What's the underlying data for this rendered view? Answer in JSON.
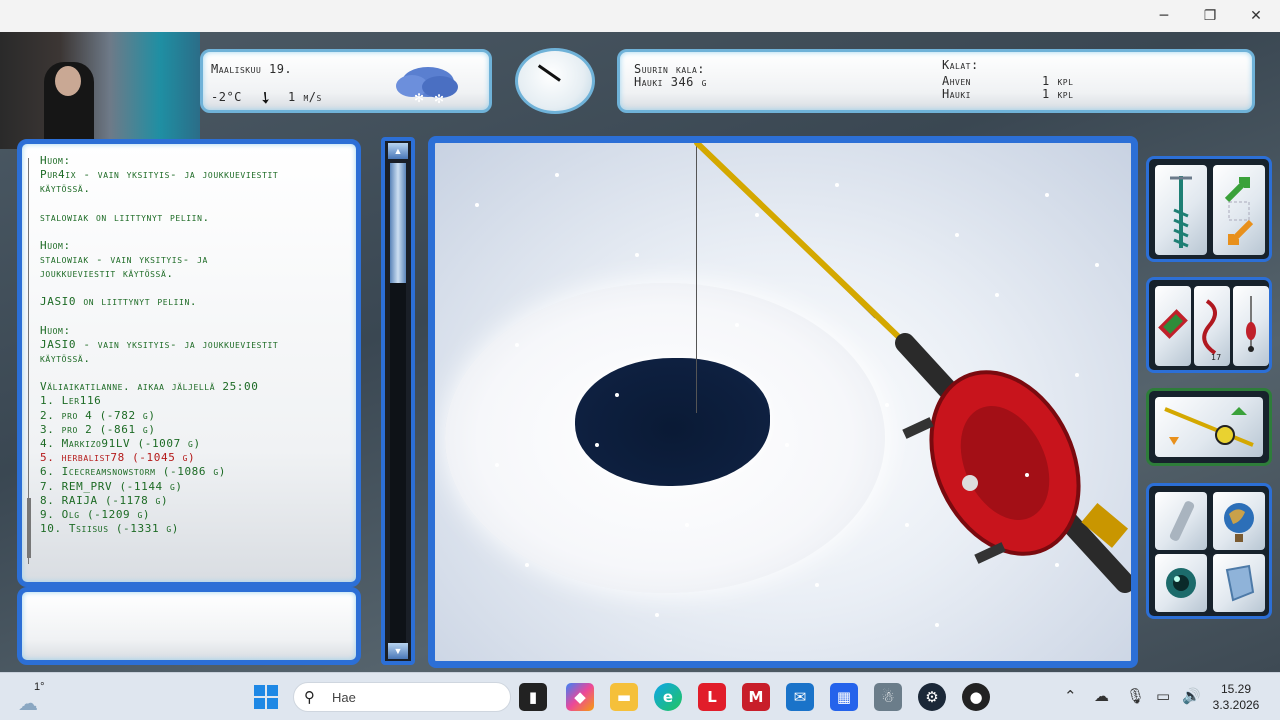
{
  "window": {
    "minimize_icon": "minimize-icon",
    "maximize_icon": "restore-icon",
    "close_icon": "close-icon",
    "minimize_glyph": "─",
    "maximize_glyph": "❐",
    "close_glyph": "✕"
  },
  "weather": {
    "date": "Maaliskuu 19.",
    "temperature": "-2°C",
    "wind": "1 m/s",
    "condition_icon": "snow-cloud-icon"
  },
  "catch": {
    "biggest_title": "Suurin kala:",
    "biggest_value": "Hauki 346 g",
    "fish_title": "Kalat:",
    "fish": [
      {
        "name": "Ahven",
        "count": "1 kpl"
      },
      {
        "name": "Hauki",
        "count": "1 kpl"
      }
    ]
  },
  "chat": {
    "lines": [
      {
        "text": "Huom:",
        "hl": false
      },
      {
        "text": "Pur4ix - vain yksityis- ja joukkueviestit\nkäytössä.",
        "hl": false
      },
      {
        "gap": true
      },
      {
        "text": "stalowiak on liittynyt peliin.",
        "hl": false
      },
      {
        "gap": true
      },
      {
        "text": "Huom:",
        "hl": false
      },
      {
        "text": "stalowiak - vain yksityis- ja\njoukkueviestit käytössä.",
        "hl": false
      },
      {
        "gap": true
      },
      {
        "text": "JASI0 on liittynyt peliin.",
        "hl": false
      },
      {
        "gap": true
      },
      {
        "text": "Huom:",
        "hl": false
      },
      {
        "text": "JASI0 - vain yksityis- ja joukkueviestit\nkäytössä.",
        "hl": false
      },
      {
        "gap": true
      },
      {
        "text": "Väliaikatilanne. aikaa jäljellä 25:00",
        "hl": false
      },
      {
        "text": "1. Ler116",
        "hl": false
      },
      {
        "text": "2. pro 4 (-782 g)",
        "hl": false
      },
      {
        "text": "3. pro 2 (-861 g)",
        "hl": false
      },
      {
        "text": "4. Markizo91LV (-1007 g)",
        "hl": false
      },
      {
        "text": "5. herbalist78 (-1045 g)",
        "hl": true
      },
      {
        "text": "6. Icecreamsnowstorm (-1086 g)",
        "hl": false
      },
      {
        "text": "7. REM_PRV (-1144 g)",
        "hl": false
      },
      {
        "text": "8. RAIJA (-1178 g)",
        "hl": false
      },
      {
        "text": "9. Olg (-1209 g)",
        "hl": false
      },
      {
        "text": "10. Tsiisus (-1331 g)",
        "hl": false
      }
    ]
  },
  "depth_slider": {
    "level": 0.25
  },
  "tools": {
    "group1": [
      "ice-drill-icon",
      "switch-arrows-icon"
    ],
    "group2": [
      "lure-icon",
      "worm-icon",
      "jig-icon"
    ],
    "group3": [
      "rod-reel-icon"
    ],
    "group4": [
      "flashlight-icon",
      "globe-icon",
      "eye-icon",
      "map-icon"
    ],
    "worm_count": "17"
  },
  "taskbar": {
    "weather_temp": "1°",
    "search_placeholder": "Hae",
    "time": "15.29",
    "date": "3.3.2026",
    "apps": [
      "file-explorer-tray-icon",
      "copilot-icon",
      "folder-icon",
      "edge-icon",
      "lenovo-icon",
      "mcafee-icon",
      "outlook-icon",
      "store-icon",
      "game-icon",
      "steam-icon",
      "obs-icon"
    ]
  }
}
